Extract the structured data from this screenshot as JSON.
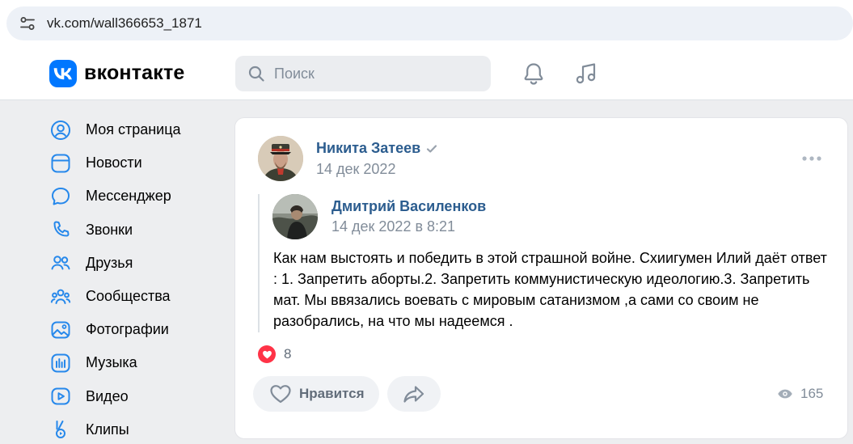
{
  "browser": {
    "url": "vk.com/wall366653_1871"
  },
  "header": {
    "logo_text": "вконтакте",
    "search_placeholder": "Поиск"
  },
  "nav": {
    "items": [
      {
        "label": "Моя страница",
        "icon": "user-circle-icon"
      },
      {
        "label": "Новости",
        "icon": "newsfeed-icon"
      },
      {
        "label": "Мессенджер",
        "icon": "chat-bubble-icon"
      },
      {
        "label": "Звонки",
        "icon": "phone-icon"
      },
      {
        "label": "Друзья",
        "icon": "friends-icon"
      },
      {
        "label": "Сообщества",
        "icon": "communities-icon"
      },
      {
        "label": "Фотографии",
        "icon": "photo-icon"
      },
      {
        "label": "Музыка",
        "icon": "music-icon"
      },
      {
        "label": "Видео",
        "icon": "video-icon"
      },
      {
        "label": "Клипы",
        "icon": "clips-icon"
      }
    ]
  },
  "post": {
    "author": "Никита Затеев",
    "date": "14 дек 2022",
    "repost": {
      "author": "Дмитрий Василенков",
      "date": "14 дек 2022 в 8:21",
      "text": "Как нам выстоять и победить в этой страшной войне. Схиигумен Илий даёт ответ : 1. Запретить аборты.2. Запретить коммунистическую идеологию.3. Запретить мат. Мы ввязались воевать с мировым сатанизмом ,а сами со своим не разобрались, на что мы надеемся ."
    },
    "likes_count": "8",
    "like_label": "Нравится",
    "views_count": "165"
  },
  "colors": {
    "accent": "#0077ff",
    "link": "#2c5d8f",
    "secondary_text": "#818c99",
    "like_red": "#ff3347",
    "background": "#edeef0"
  }
}
